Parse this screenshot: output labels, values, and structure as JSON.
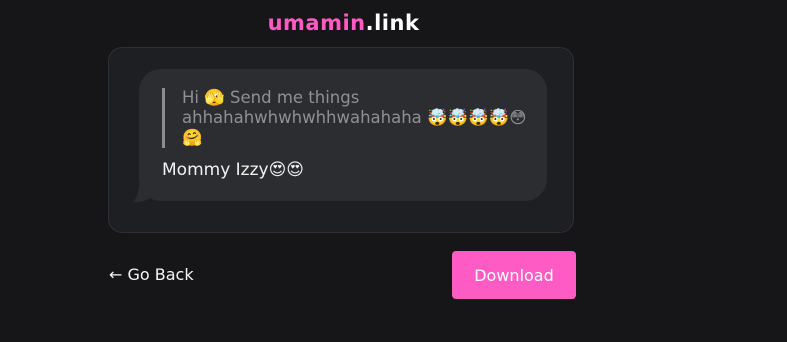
{
  "header": {
    "logo_brand": "umamin",
    "logo_dot": ".",
    "logo_tld": "link"
  },
  "message": {
    "quote_text": "Hi 🫣 Send me things ahhahahwhwhwhhwahahaha 🤯🤯🤯🤯😳🤗",
    "reply_text": "Mommy Izzy😍😍"
  },
  "actions": {
    "back_label": "← Go Back",
    "download_label": "Download"
  },
  "colors": {
    "accent": "#ff5bc4",
    "background": "#161618",
    "card": "#1e1f22",
    "bubble": "#2c2d31"
  }
}
